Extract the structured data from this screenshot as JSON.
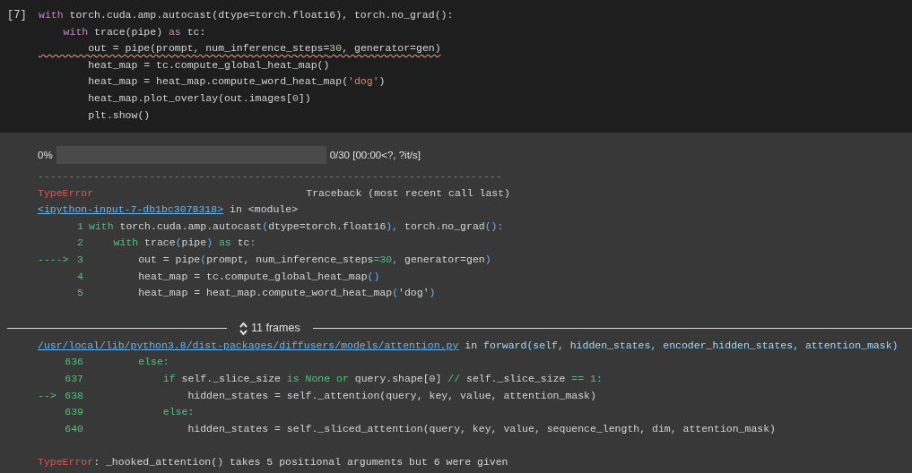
{
  "cell": {
    "prompt": "[7]",
    "lines": [
      {
        "error_underline": false,
        "tokens": [
          {
            "kind": "kw",
            "text": "with"
          },
          {
            "kind": "plain",
            "text": " torch.cuda.amp.autocast(dtype=torch.float16), torch.no_grad():"
          }
        ]
      },
      {
        "error_underline": false,
        "tokens": [
          {
            "kind": "kw",
            "text": "    with"
          },
          {
            "kind": "plain",
            "text": " trace(pipe) "
          },
          {
            "kind": "kw",
            "text": "as"
          },
          {
            "kind": "plain",
            "text": " tc:"
          }
        ]
      },
      {
        "error_underline": true,
        "tokens": [
          {
            "kind": "plain",
            "text": "        out = pipe(prompt, num_inference_steps="
          },
          {
            "kind": "num",
            "text": "30"
          },
          {
            "kind": "plain",
            "text": ", generator=gen)"
          }
        ]
      },
      {
        "error_underline": false,
        "tokens": [
          {
            "kind": "plain",
            "text": "        heat_map = tc.compute_global_heat_map()"
          }
        ]
      },
      {
        "error_underline": false,
        "tokens": [
          {
            "kind": "plain",
            "text": "        heat_map = heat_map.compute_word_heat_map("
          },
          {
            "kind": "str",
            "text": "'dog'"
          },
          {
            "kind": "plain",
            "text": ")"
          }
        ]
      },
      {
        "error_underline": false,
        "tokens": [
          {
            "kind": "plain",
            "text": "        heat_map.plot_overlay(out.images["
          },
          {
            "kind": "num",
            "text": "0"
          },
          {
            "kind": "plain",
            "text": "])"
          }
        ]
      },
      {
        "error_underline": false,
        "tokens": [
          {
            "kind": "plain",
            "text": "        plt.show()"
          }
        ]
      }
    ]
  },
  "output": {
    "progress": {
      "percent": "0%",
      "level": 0,
      "stats": "0/30 [00:00<?, ?it/s]"
    },
    "separator": "---------------------------------------------------------------------------",
    "error_type": "TypeError",
    "traceback_label": "Traceback (most recent call last)",
    "frames": [
      {
        "link": "<ipython-input-7-db1bc3078318>",
        "connector": "in",
        "function": "<module>",
        "function_colored": false,
        "lines": [
          {
            "number": "1",
            "tokens": [
              {
                "kind": "kw",
                "text": "with"
              },
              {
                "kind": "plain",
                "text": " torch.cuda.amp.autocast"
              },
              {
                "kind": "punct",
                "text": "("
              },
              {
                "kind": "plain",
                "text": "dtype=torch.float16"
              },
              {
                "kind": "punct",
                "text": "),"
              },
              {
                "kind": "plain",
                "text": " torch.no_grad"
              },
              {
                "kind": "punct",
                "text": "():"
              }
            ]
          },
          {
            "number": "2",
            "tokens": [
              {
                "kind": "kw",
                "text": "    with"
              },
              {
                "kind": "plain",
                "text": " trace"
              },
              {
                "kind": "punct",
                "text": "("
              },
              {
                "kind": "plain",
                "text": "pipe"
              },
              {
                "kind": "punct",
                "text": ")"
              },
              {
                "kind": "kw",
                "text": " as"
              },
              {
                "kind": "plain",
                "text": " tc"
              },
              {
                "kind": "punct",
                "text": ":"
              }
            ]
          },
          {
            "arrow": "---->",
            "number": "3",
            "tokens": [
              {
                "kind": "plain",
                "text": "        out = pipe"
              },
              {
                "kind": "punct",
                "text": "("
              },
              {
                "kind": "plain",
                "text": "prompt, num_inference_steps"
              },
              {
                "kind": "op",
                "text": "="
              },
              {
                "kind": "num",
                "text": "30"
              },
              {
                "kind": "punct",
                "text": ","
              },
              {
                "kind": "plain",
                "text": " generator=gen"
              },
              {
                "kind": "punct",
                "text": ")"
              }
            ]
          },
          {
            "number": "4",
            "tokens": [
              {
                "kind": "plain",
                "text": "        heat_map = tc.compute_global_heat_map"
              },
              {
                "kind": "punct",
                "text": "()"
              }
            ]
          },
          {
            "number": "5",
            "tokens": [
              {
                "kind": "plain",
                "text": "        heat_map = heat_map.compute_word_heat_map"
              },
              {
                "kind": "punct",
                "text": "("
              },
              {
                "kind": "plain",
                "text": "'dog'"
              },
              {
                "kind": "punct",
                "text": ")"
              }
            ]
          }
        ]
      },
      {
        "link": "/usr/local/lib/python3.8/dist-packages/diffusers/models/attention.py",
        "connector": "in",
        "function": "forward(self, hidden_states, encoder_hidden_states, attention_mask)",
        "function_colored": true,
        "collapsed_label": "11 frames",
        "lines": [
          {
            "number": "636",
            "tokens": [
              {
                "kind": "kw",
                "text": "        else"
              },
              {
                "kind": "punct",
                "text": ":"
              }
            ]
          },
          {
            "number": "637",
            "tokens": [
              {
                "kind": "kw",
                "text": "            if"
              },
              {
                "kind": "plain",
                "text": " self._slice_size "
              },
              {
                "kind": "kw",
                "text": "is None or"
              },
              {
                "kind": "plain",
                "text": " query.shape[0] "
              },
              {
                "kind": "op",
                "text": "//"
              },
              {
                "kind": "plain",
                "text": " self._slice_size "
              },
              {
                "kind": "op",
                "text": "=="
              },
              {
                "kind": "num",
                "text": " 1"
              },
              {
                "kind": "punct",
                "text": ":"
              }
            ]
          },
          {
            "arrow": "-->",
            "number": "638",
            "tokens": [
              {
                "kind": "plain",
                "text": "                hidden_states = self._attention(query, key, value, attention_mask)"
              }
            ]
          },
          {
            "number": "639",
            "tokens": [
              {
                "kind": "kw",
                "text": "            else"
              },
              {
                "kind": "punct",
                "text": ":"
              }
            ]
          },
          {
            "number": "640",
            "tokens": [
              {
                "kind": "plain",
                "text": "                hidden_states = self._sliced_attention(query, key, value, sequence_length, dim, attention_mask)"
              }
            ]
          }
        ]
      }
    ],
    "error_message": {
      "type": "TypeError",
      "message": ": _hooked_attention() takes 5 positional arguments but 6 were given"
    }
  }
}
